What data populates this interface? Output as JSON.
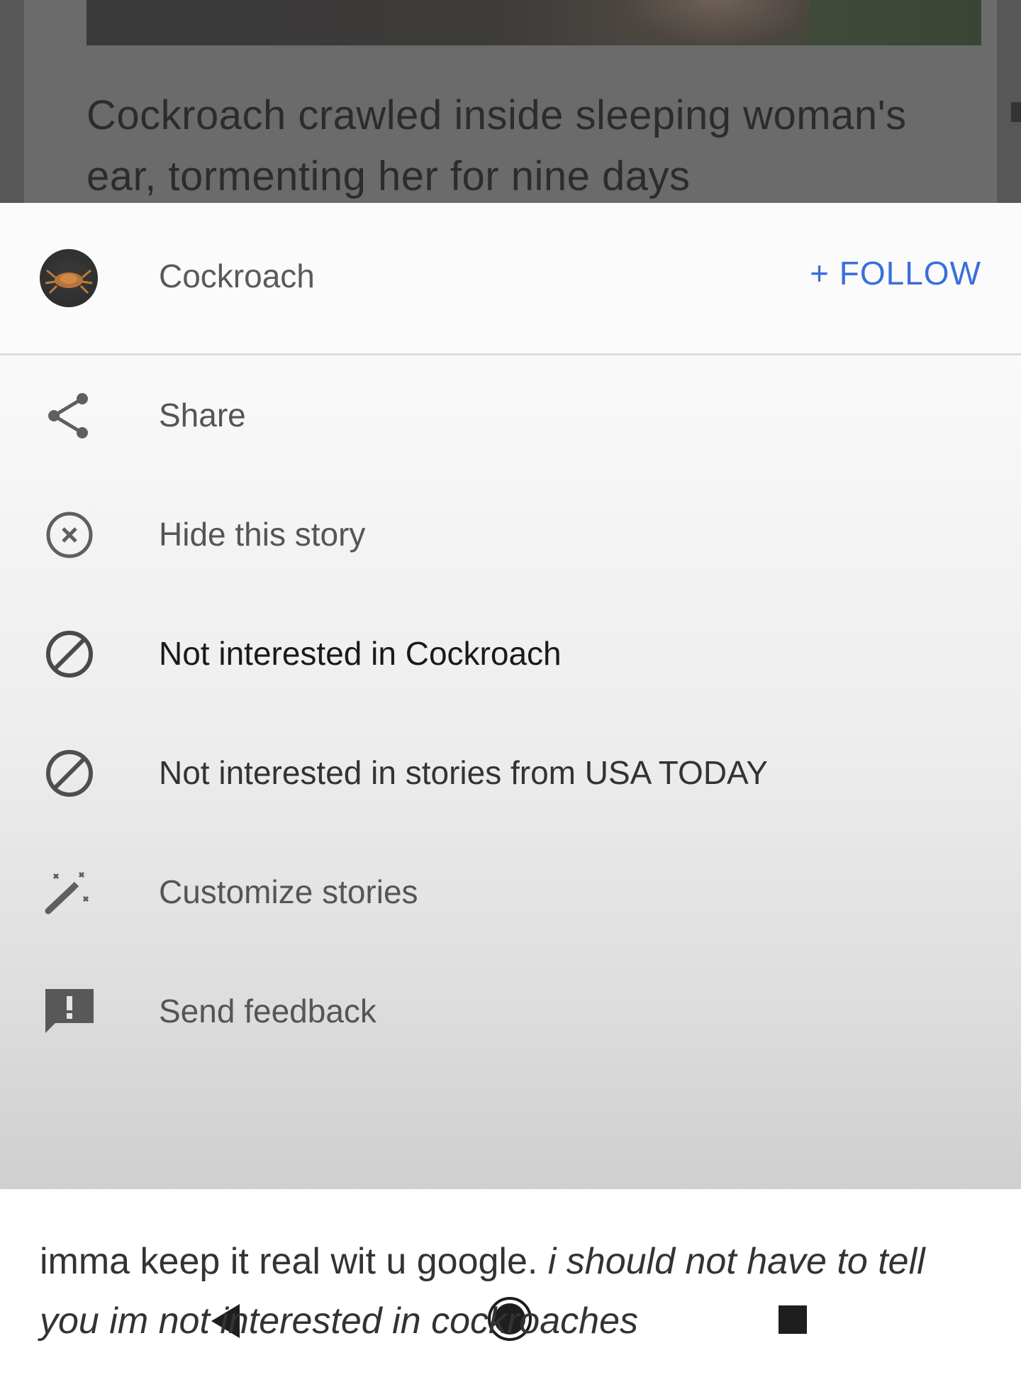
{
  "story": {
    "title_line1": "Cockroach crawled inside sleeping woman's",
    "title_line2": "ear, tormenting her for nine days"
  },
  "sheet": {
    "topic": {
      "name": "Cockroach",
      "follow_label": "+ FOLLOW",
      "follow_color": "#3a6edb"
    },
    "menu": [
      {
        "label": "Share",
        "icon": "share-icon"
      },
      {
        "label": "Hide this story",
        "icon": "close-circle-icon"
      },
      {
        "label": "Not interested in Cockroach",
        "icon": "block-icon"
      },
      {
        "label": "Not interested in stories from USA TODAY",
        "icon": "block-icon"
      },
      {
        "label": "Customize stories",
        "icon": "magic-wand-icon"
      },
      {
        "label": "Send feedback",
        "icon": "feedback-icon"
      }
    ]
  },
  "navbar": {
    "buttons": [
      "back-icon",
      "home-icon",
      "recents-icon"
    ]
  },
  "caption": {
    "plain": "imma keep it real wit u google. ",
    "italic": "i should not have to tell you im not interested in cockroaches"
  }
}
